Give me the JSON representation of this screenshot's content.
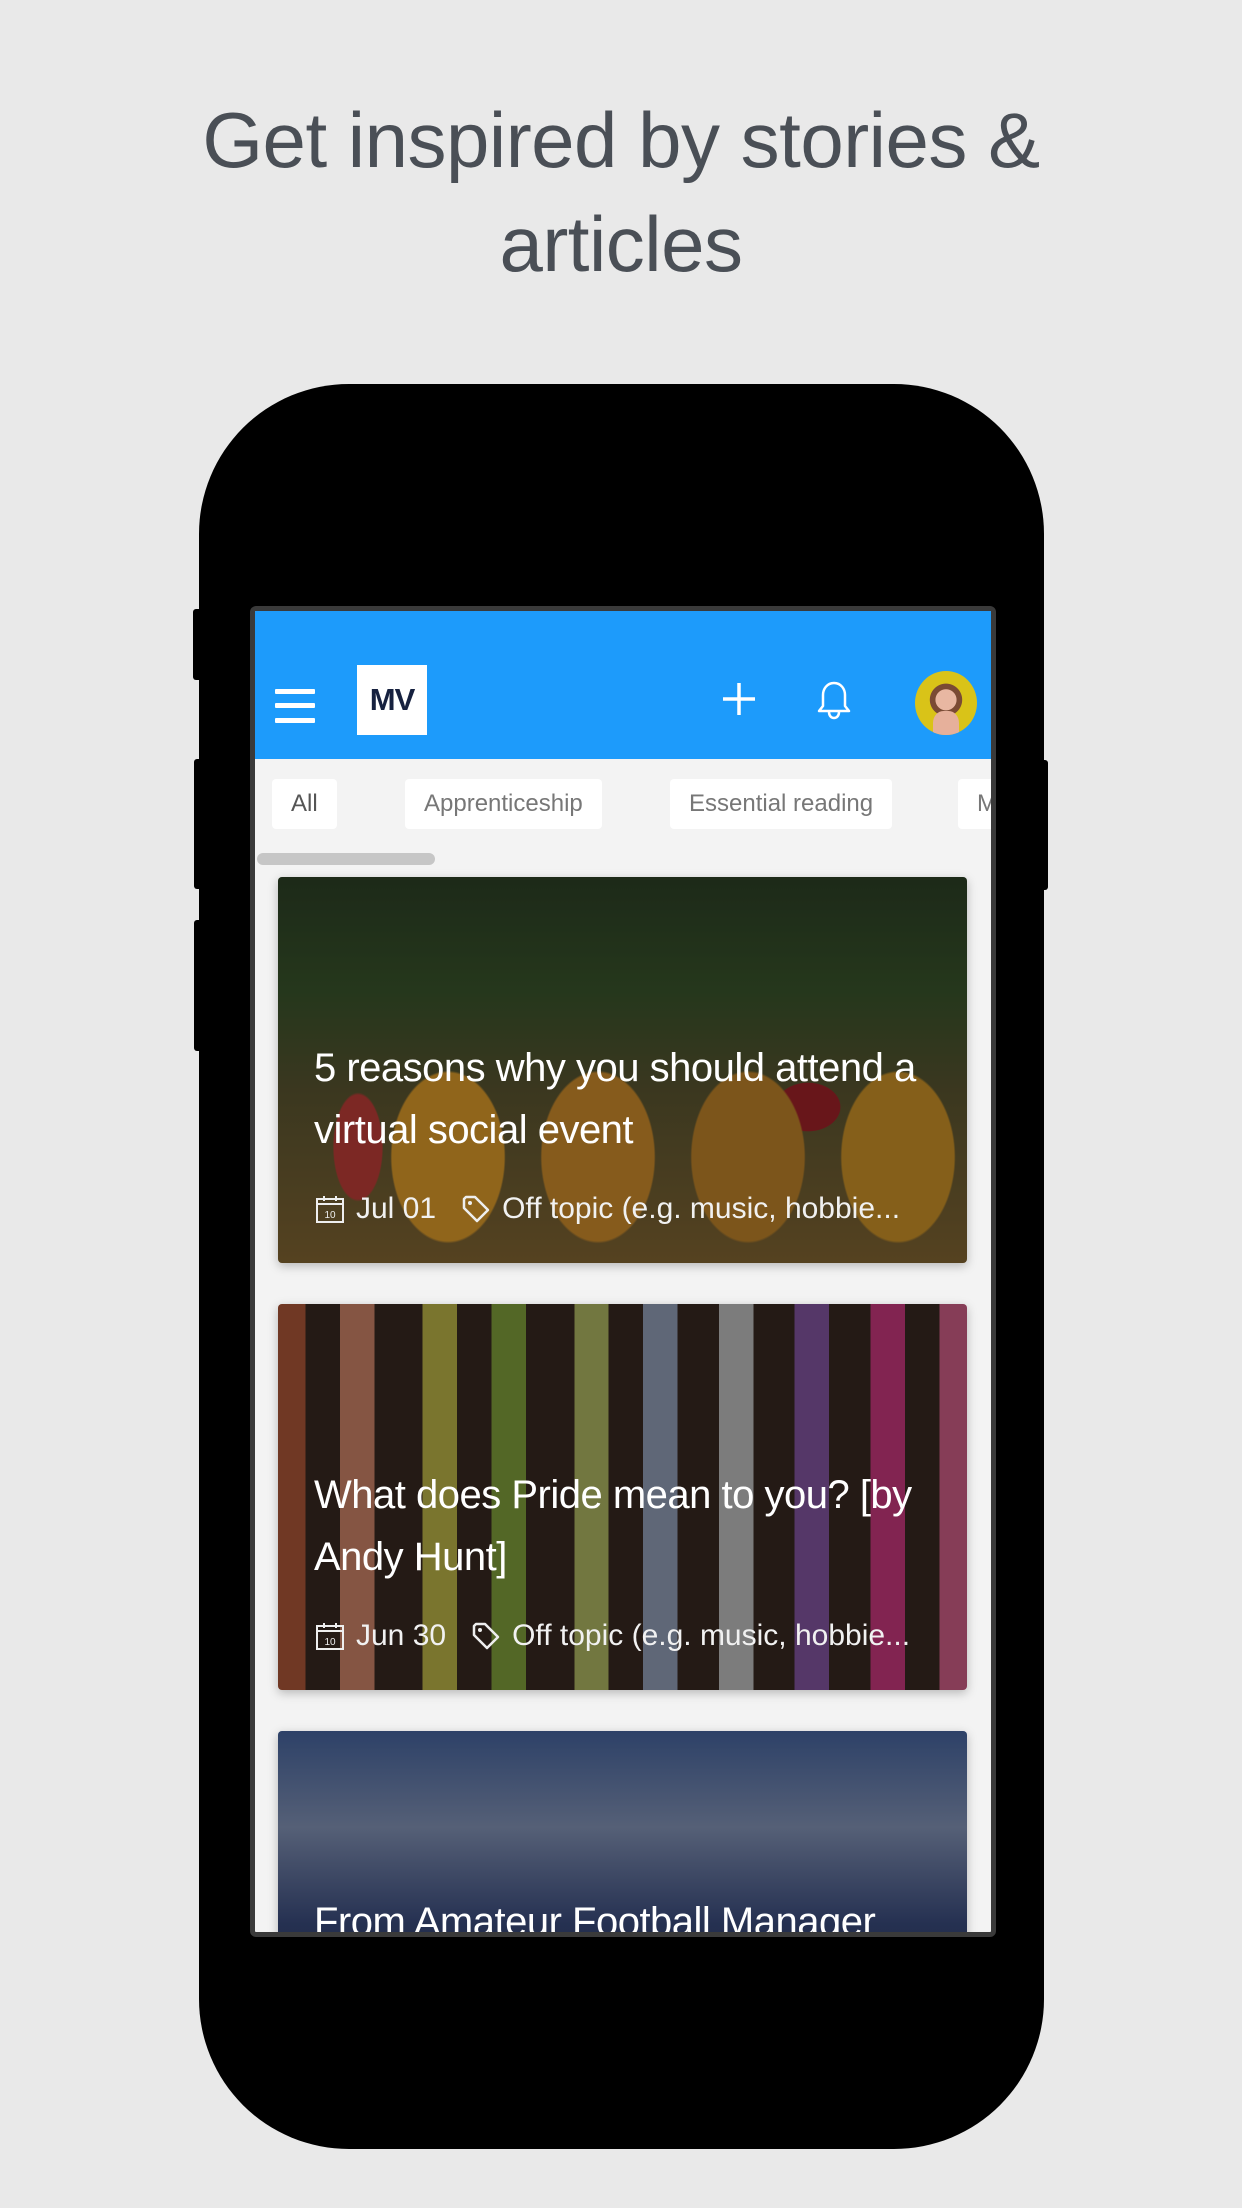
{
  "headline": {
    "line1": "Get inspired by stories &",
    "line2": "articles"
  },
  "app": {
    "brand_color": "#1d9bfb",
    "logo_text": "MV",
    "icons": {
      "menu": "hamburger-menu-icon",
      "add": "plus-icon",
      "notifications": "bell-icon",
      "profile": "avatar"
    }
  },
  "filters": {
    "chips": [
      {
        "label": "All",
        "active": true
      },
      {
        "label": "Apprenticeship",
        "active": false
      },
      {
        "label": "Essential reading",
        "active": false
      },
      {
        "label": "M",
        "active": false
      }
    ]
  },
  "feed": {
    "articles": [
      {
        "title": "5 reasons why you should attend a virtual social event",
        "date": "Jul 01",
        "category": "Off topic (e.g. music, hobbie..."
      },
      {
        "title": "What does Pride mean to you? [by Andy Hunt]",
        "date": "Jun 30",
        "category": "Off topic (e.g. music, hobbie..."
      },
      {
        "title": "From Amateur Football Manager",
        "date": "",
        "category": ""
      }
    ]
  }
}
